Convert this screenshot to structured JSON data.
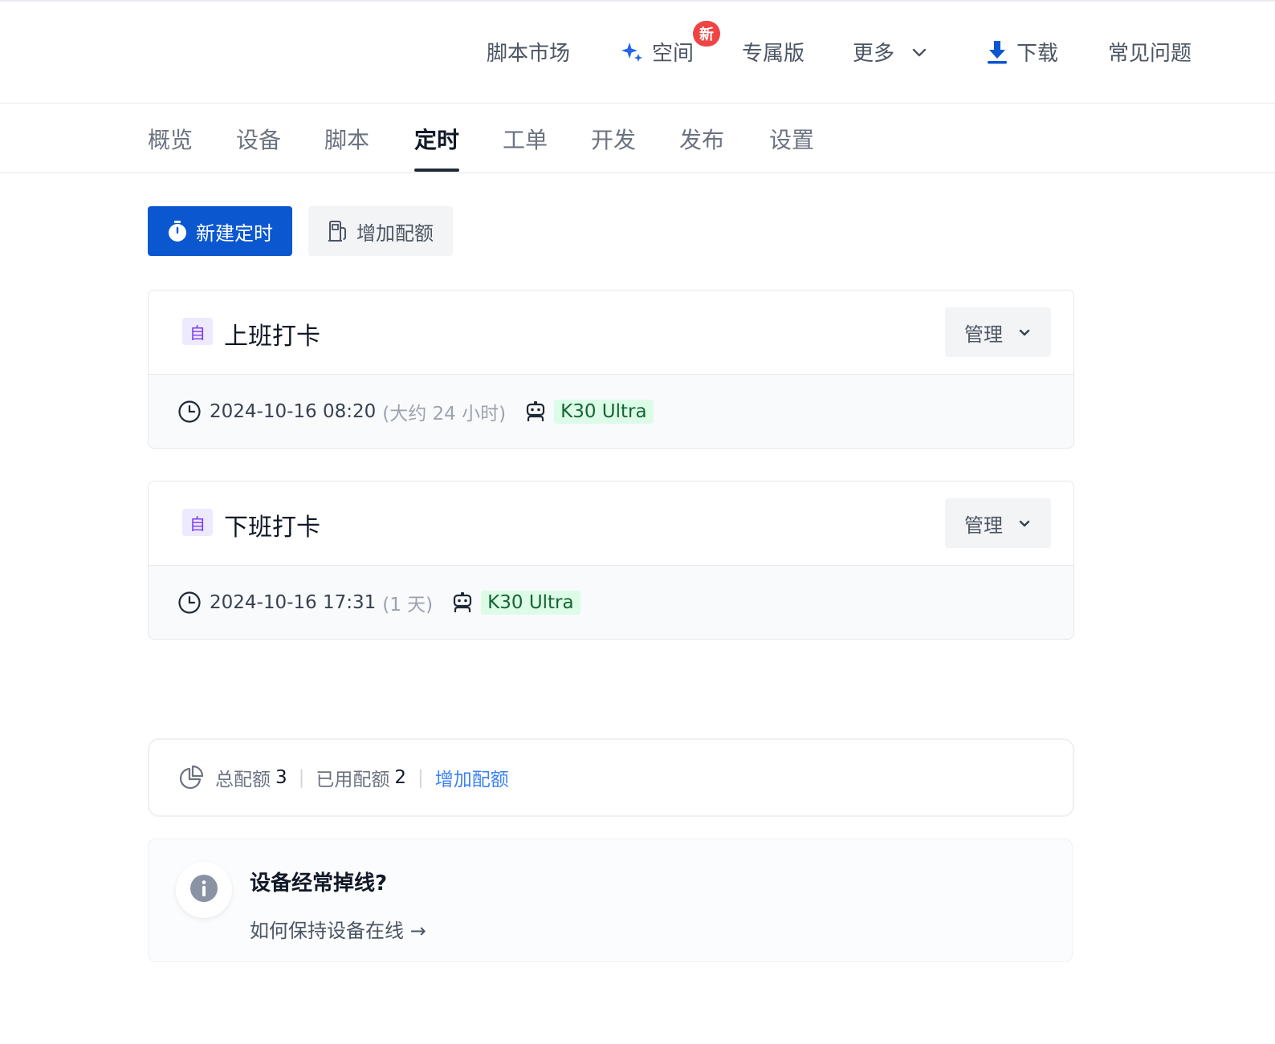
{
  "topnav": {
    "items": [
      {
        "label": "脚本市场"
      },
      {
        "label": "空间",
        "badge": "新"
      },
      {
        "label": "专属版"
      },
      {
        "label": "更多"
      },
      {
        "label": "下载"
      },
      {
        "label": "常见问题"
      }
    ]
  },
  "tabs": [
    {
      "label": "概览"
    },
    {
      "label": "设备"
    },
    {
      "label": "脚本"
    },
    {
      "label": "定时",
      "active": true
    },
    {
      "label": "工单"
    },
    {
      "label": "开发"
    },
    {
      "label": "发布"
    },
    {
      "label": "设置"
    }
  ],
  "actions": {
    "new_schedule": "新建定时",
    "add_quota": "增加配额"
  },
  "schedules": [
    {
      "tag": "自",
      "title": "上班打卡",
      "manage": "管理",
      "time": "2024-10-16 08:20",
      "relative": "(大约 24 小时)",
      "device": "K30 Ultra"
    },
    {
      "tag": "自",
      "title": "下班打卡",
      "manage": "管理",
      "time": "2024-10-16 17:31",
      "relative": "(1 天)",
      "device": "K30 Ultra"
    }
  ],
  "quota": {
    "total_label": "总配额",
    "total_value": "3",
    "used_label": "已用配额",
    "used_value": "2",
    "add_link": "增加配额"
  },
  "info": {
    "title": "设备经常掉线?",
    "link": "如何保持设备在线 →"
  },
  "colors": {
    "primary": "#0b57d0",
    "badge": "#ef4444",
    "device_tag_bg": "#dcfce7",
    "auto_tag_bg": "#ede9fe",
    "link": "#3b82f6"
  }
}
